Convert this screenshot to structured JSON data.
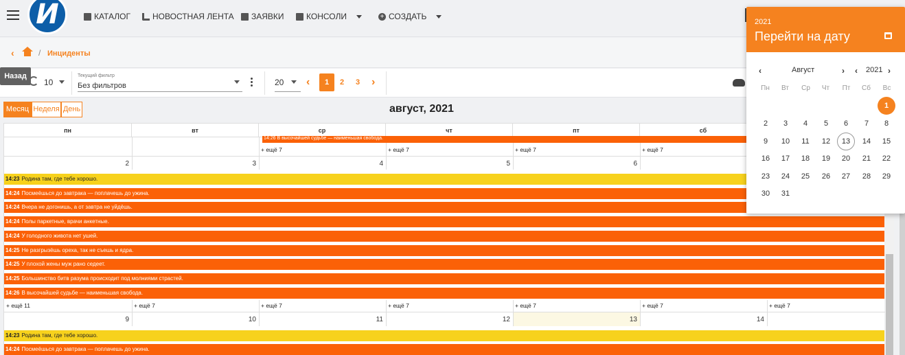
{
  "nav": {
    "catalog": "КАТАЛОГ",
    "news": "НОВОСТНАЯ ЛЕНТА",
    "requests": "ЗАЯВКИ",
    "consoles": "КОНСОЛИ",
    "create": "СОЗДАТЬ"
  },
  "breadcrumb": {
    "current": "Инциденты"
  },
  "toolbar": {
    "back_tooltip": "Назад",
    "refresh_interval": "10",
    "filter_label": "Текущий фильтр",
    "filter_value": "Без фильтров",
    "page_size": "20",
    "pages": [
      "1",
      "2",
      "3"
    ],
    "active_page": "1"
  },
  "calendar": {
    "views": [
      "Месяц",
      "Неделя",
      "День"
    ],
    "active_view": "Месяц",
    "title": "август, 2021",
    "weekdays": [
      "пн",
      "вт",
      "ср",
      "чт",
      "пт",
      "сб"
    ],
    "row1_partial_event": "14:26  В высочайшей судьбе — наименьшая свобода.",
    "row1_more": [
      "+ ещё 7",
      "+ ещё 7",
      "+ ещё 7",
      "+ ещё 7"
    ],
    "week2_days": [
      "2",
      "3",
      "4",
      "5",
      "6"
    ],
    "week2_more": [
      "+ ещё 11",
      "+ ещё 7",
      "+ ещё 7",
      "+ ещё 7",
      "+ ещё 7",
      "+ ещё 7",
      "+ ещё 7"
    ],
    "week3_days": [
      "9",
      "10",
      "11",
      "12",
      "13",
      "14"
    ],
    "today": "13",
    "events_week2": [
      {
        "time": "14:23",
        "text": "Родина там, где тебе хорошо.",
        "color": "yellow"
      },
      {
        "time": "14:24",
        "text": "Посмеёшься до завтрака — поплачешь до ужина.",
        "color": "orange"
      },
      {
        "time": "14:24",
        "text": "Вчера не догонишь, а от завтра не уйдёшь.",
        "color": "orange"
      },
      {
        "time": "14:24",
        "text": "Полы паркетные, врачи анкетные.",
        "color": "orange"
      },
      {
        "time": "14:24",
        "text": "У голодного живота нет ушей.",
        "color": "orange"
      },
      {
        "time": "14:25",
        "text": "Не разгрызёшь ореха, так не съешь и ядра.",
        "color": "orange"
      },
      {
        "time": "14:25",
        "text": "У плохой жены муж рано седеет.",
        "color": "orange"
      },
      {
        "time": "14:25",
        "text": "Большинство битв разума происходит под молниями страстей.",
        "color": "orange"
      },
      {
        "time": "14:26",
        "text": "В высочайшей судьбе — наименьшая свобода.",
        "color": "orange"
      }
    ],
    "events_week3": [
      {
        "time": "14:23",
        "text": "Родина там, где тебе хорошо.",
        "color": "yellow"
      },
      {
        "time": "14:24",
        "text": "Посмеёшься до завтрака — поплачешь до ужина.",
        "color": "orange"
      }
    ]
  },
  "picker": {
    "year": "2021",
    "title": "Перейти на дату",
    "month": "Август",
    "nav_year": "2021",
    "weekdays": [
      "Пн",
      "Вт",
      "Ср",
      "Чт",
      "Пт",
      "Сб",
      "Вс"
    ],
    "selected": "1",
    "today": "13",
    "weeks": [
      [
        "",
        "",
        "",
        "",
        "",
        "",
        "1"
      ],
      [
        "2",
        "3",
        "4",
        "5",
        "6",
        "7",
        "8"
      ],
      [
        "9",
        "10",
        "11",
        "12",
        "13",
        "14",
        "15"
      ],
      [
        "16",
        "17",
        "18",
        "19",
        "20",
        "21",
        "22"
      ],
      [
        "23",
        "24",
        "25",
        "26",
        "27",
        "28",
        "29"
      ],
      [
        "30",
        "31",
        "",
        "",
        "",
        "",
        ""
      ]
    ]
  },
  "colors": {
    "accent": "#f5821f",
    "event_orange": "#fb6107",
    "event_yellow": "#f7d21d",
    "today_bg": "#fcf8e3"
  }
}
